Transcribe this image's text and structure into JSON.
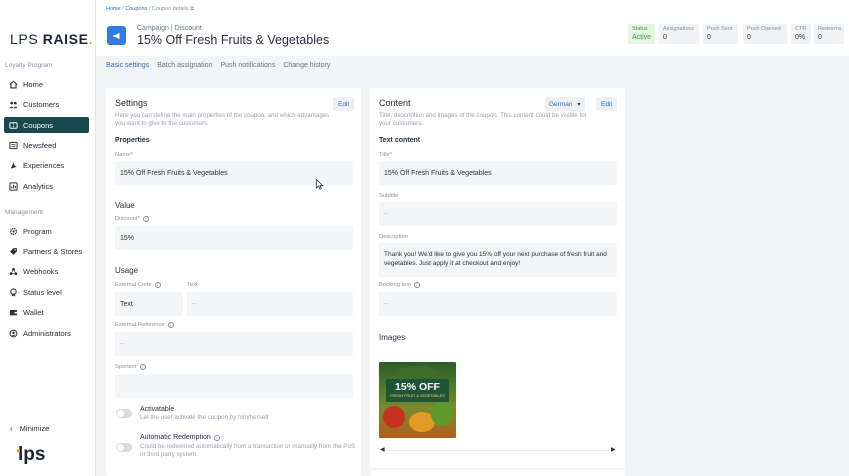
{
  "app": {
    "logo_text": "LPS",
    "logo_bold": "RAISE",
    "logo_dot": ".",
    "bottom_brand": "lps"
  },
  "sidebar": {
    "section_loyalty": "Loyalty Program",
    "section_management": "Management",
    "items": [
      {
        "label": "Home",
        "icon": "home-icon"
      },
      {
        "label": "Customers",
        "icon": "customers-icon"
      },
      {
        "label": "Coupons",
        "icon": "coupon-icon",
        "active": true
      },
      {
        "label": "Newsfeed",
        "icon": "newsfeed-icon"
      },
      {
        "label": "Experiences",
        "icon": "experiences-icon"
      },
      {
        "label": "Analytics",
        "icon": "analytics-icon"
      }
    ],
    "management_items": [
      {
        "label": "Program",
        "icon": "gear-icon"
      },
      {
        "label": "Partners & Stores",
        "icon": "partners-icon"
      },
      {
        "label": "Webhooks",
        "icon": "webhooks-icon"
      },
      {
        "label": "Status level",
        "icon": "status-level-icon"
      },
      {
        "label": "Wallet",
        "icon": "wallet-icon"
      },
      {
        "label": "Administrators",
        "icon": "administrators-icon"
      }
    ],
    "minimize_label": "Minimize"
  },
  "header": {
    "breadcrumb": [
      "Home",
      "Coupons",
      "Coupon details"
    ],
    "subtitle": "Campaign | Discount",
    "title": "15% Off Fresh Fruits & Vegetables",
    "stats": [
      {
        "label": "Status",
        "value": "Active"
      },
      {
        "label": "Assignations",
        "value": "0"
      },
      {
        "label": "Push Sent",
        "value": "0"
      },
      {
        "label": "Push Opened",
        "value": "0"
      },
      {
        "label": "CTR",
        "value": "0%"
      },
      {
        "label": "Redeems",
        "value": "0"
      }
    ]
  },
  "tabs": [
    "Basic settings",
    "Batch assignation",
    "Push notifications",
    "Change history"
  ],
  "settings": {
    "title": "Settings",
    "edit_label": "Edit",
    "description": "Here you can define the main properties of the coupon, and which advantages you want to give to the customers.",
    "properties_heading": "Properties",
    "name_label": "Name*",
    "name_value": "15% Off Fresh Fruits & Vegetables",
    "value_heading": "Value",
    "discount_label": "Discount*",
    "discount_value": "15%",
    "usage_heading": "Usage",
    "external_code_label": "External Code",
    "external_code_value": "Text",
    "text_label": "Text",
    "text_value": "--",
    "external_reference_label": "External Reference",
    "external_reference_value": "--",
    "sponsor_label": "Sponsor",
    "sponsor_value": "",
    "activatable_title": "Activatable",
    "activatable_desc": "Let the user activate the coupon by him/herself",
    "auto_redemption_title": "Automatic Redemption",
    "auto_redemption_desc": "Could be redeemed automatically from a transaction or manually from the PoS or third party system."
  },
  "content": {
    "title": "Content",
    "language": "German",
    "edit_label": "Edit",
    "description": "Title, description and images of the coupon. This content could be visible for your customers.",
    "text_content_heading": "Text content",
    "title_label": "Title*",
    "title_value": "15% Off Fresh Fruits & Vegetables",
    "subtitle_label": "Subtitle",
    "subtitle_value": "--",
    "description_label": "Description",
    "description_value": "Thank you! We'd like to give you 15% off your next purchase of fresh fruit and vegetables. Just apply it at checkout and enjoy!",
    "booking_text_label": "Booking text",
    "booking_text_value": "--",
    "images_heading": "Images",
    "image_headline": "15% OFF",
    "image_subline": "FRESH FRUIT & VEGETABLES"
  },
  "colors": {
    "active_nav": "#17494f",
    "accent": "#2f6fb3",
    "brand_orange": "#f2a21b",
    "status_green": "#3f9b3a"
  }
}
